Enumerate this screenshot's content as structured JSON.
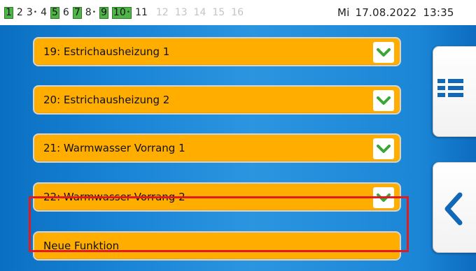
{
  "statusbar": {
    "indicators": [
      {
        "label": "1",
        "state": "active"
      },
      {
        "label": "2",
        "state": "normal"
      },
      {
        "label": "3",
        "state": "normal",
        "dot": true
      },
      {
        "label": "4",
        "state": "normal"
      },
      {
        "label": "5",
        "state": "active"
      },
      {
        "label": "6",
        "state": "normal"
      },
      {
        "label": "7",
        "state": "active"
      },
      {
        "label": "8",
        "state": "normal",
        "dot": true
      },
      {
        "label": "9",
        "state": "active"
      },
      {
        "label": "10",
        "state": "active",
        "dot": true
      },
      {
        "label": "11",
        "state": "normal"
      },
      {
        "label": "12",
        "state": "inactive"
      },
      {
        "label": "13",
        "state": "inactive"
      },
      {
        "label": "14",
        "state": "inactive"
      },
      {
        "label": "15",
        "state": "inactive"
      },
      {
        "label": "16",
        "state": "inactive"
      }
    ],
    "weekday": "Mi",
    "date": "17.08.2022",
    "time": "13:35"
  },
  "functions": [
    {
      "label": "19: Estrichausheizung 1"
    },
    {
      "label": "20: Estrichausheizung 2"
    },
    {
      "label": "21: Warmwasser Vorrang 1"
    },
    {
      "label": "22: Warmwasser Vorrang 2"
    }
  ],
  "new_function": {
    "label": "Neue Funktion"
  },
  "colors": {
    "item": "#ffae00",
    "panel": "#1a85d6",
    "highlight": "#e11b22",
    "indicator_active": "#4fb548",
    "check": "#3aa635",
    "icon_blue": "#1168b8"
  },
  "icons": {
    "expand": "chevron-down-icon",
    "list_view": "list-view-icon",
    "back": "chevron-left-icon"
  }
}
